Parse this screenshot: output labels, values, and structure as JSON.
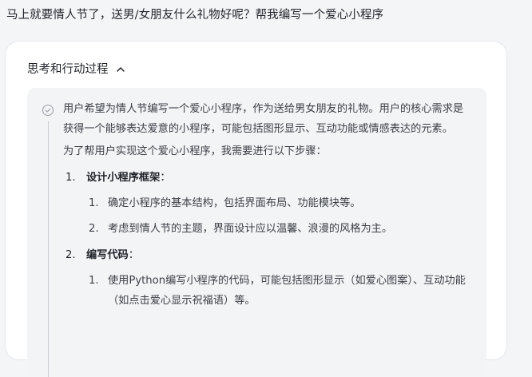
{
  "question": "马上就要情人节了，送男/女朋友什么礼物好呢？帮我编写一个爱心小程序",
  "process": {
    "title": "思考和行动过程",
    "toggle_icon": "chevron-up-icon",
    "status_icon": "check-circle-icon"
  },
  "thinking": {
    "intro_1": "用户希望为情人节编写一个爱心小程序，作为送给男女朋友的礼物。用户的核心需求是获得一个能够表达爱意的小程序，可能包括图形显示、互动功能或情感表达的元素。",
    "intro_2": "为了帮用户实现这个爱心小程序，我需要进行以下步骤：",
    "steps": [
      {
        "num": "1.",
        "title": "设计小程序框架",
        "colon": "：",
        "subs": [
          {
            "num": "1.",
            "text": "确定小程序的基本结构，包括界面布局、功能模块等。"
          },
          {
            "num": "2.",
            "text": "考虑到情人节的主题，界面设计应以温馨、浪漫的风格为主。"
          }
        ]
      },
      {
        "num": "2.",
        "title": "编写代码",
        "colon": "：",
        "subs": [
          {
            "num": "1.",
            "text": "使用Python编写小程序的代码，可能包括图形显示（如爱心图案）、互动功能（如点击爱心显示祝福语）等。"
          }
        ]
      }
    ]
  }
}
